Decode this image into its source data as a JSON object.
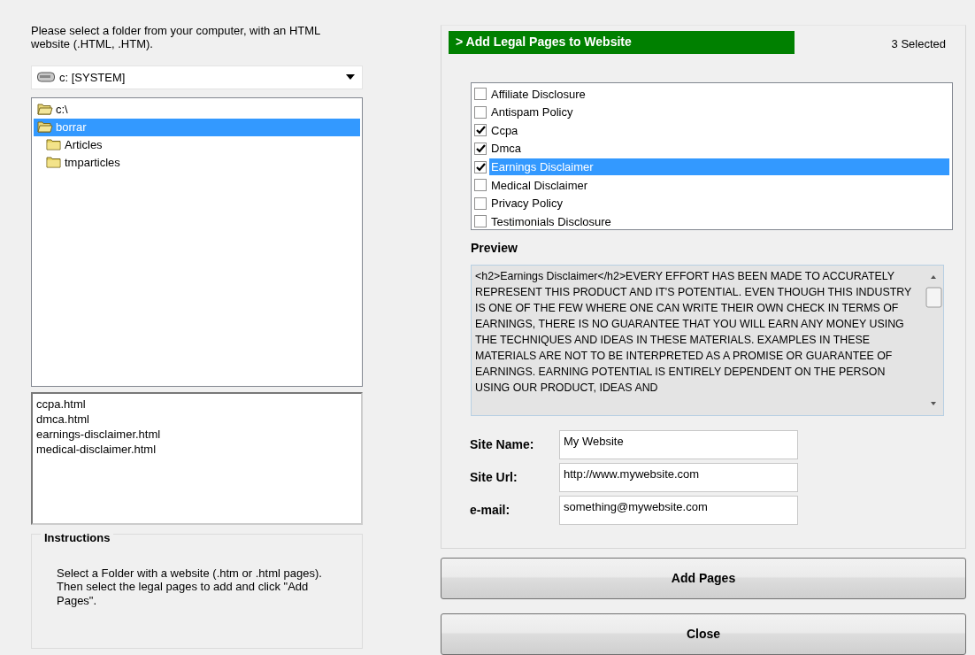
{
  "intro": "Please select a folder from your computer, with an HTML website (.HTML, .HTM).",
  "drive": {
    "value": "c: [SYSTEM]"
  },
  "folders": [
    {
      "label": "c:\\",
      "kind": "open",
      "selected": false
    },
    {
      "label": "borrar",
      "kind": "open",
      "selected": true
    },
    {
      "label": "Articles",
      "kind": "closed",
      "selected": false
    },
    {
      "label": "tmparticles",
      "kind": "closed",
      "selected": false
    }
  ],
  "files": [
    "ccpa.html",
    "dmca.html",
    "earnings-disclaimer.html",
    "medical-disclaimer.html"
  ],
  "instructions": {
    "title": "Instructions",
    "text": "Select a Folder with a website (.htm or .html pages). Then select the legal pages to add and click \"Add Pages\"."
  },
  "header": {
    "title": "> Add  Legal Pages to Website",
    "count": "3 Selected"
  },
  "pages": [
    {
      "label": "Affiliate Disclosure",
      "checked": false,
      "selected": false
    },
    {
      "label": "Antispam Policy",
      "checked": false,
      "selected": false
    },
    {
      "label": "Ccpa",
      "checked": true,
      "selected": false
    },
    {
      "label": "Dmca",
      "checked": true,
      "selected": false
    },
    {
      "label": "Earnings Disclaimer",
      "checked": true,
      "selected": true
    },
    {
      "label": "Medical Disclaimer",
      "checked": false,
      "selected": false
    },
    {
      "label": "Privacy Policy",
      "checked": false,
      "selected": false
    },
    {
      "label": "Testimonials Disclosure",
      "checked": false,
      "selected": false
    }
  ],
  "preview": {
    "label": "Preview",
    "text": "<h2>Earnings Disclaimer</h2>EVERY EFFORT HAS BEEN MADE TO ACCURATELY REPRESENT THIS PRODUCT AND IT'S POTENTIAL. EVEN THOUGH THIS INDUSTRY IS ONE OF THE FEW WHERE ONE CAN WRITE THEIR OWN CHECK IN TERMS OF EARNINGS, THERE IS NO GUARANTEE THAT YOU WILL EARN ANY MONEY USING THE TECHNIQUES AND IDEAS IN THESE MATERIALS. EXAMPLES IN THESE MATERIALS ARE NOT TO BE INTERPRETED AS A PROMISE OR GUARANTEE OF EARNINGS. EARNING POTENTIAL IS ENTIRELY DEPENDENT ON THE PERSON USING OUR PRODUCT, IDEAS AND"
  },
  "fields": [
    {
      "label": "Site Name:",
      "value": "My Website"
    },
    {
      "label": "Site Url:",
      "value": "http://www.mywebsite.com"
    },
    {
      "label": "e-mail:",
      "value": "something@mywebsite.com"
    }
  ],
  "buttons": [
    "Add Pages",
    "Close"
  ]
}
